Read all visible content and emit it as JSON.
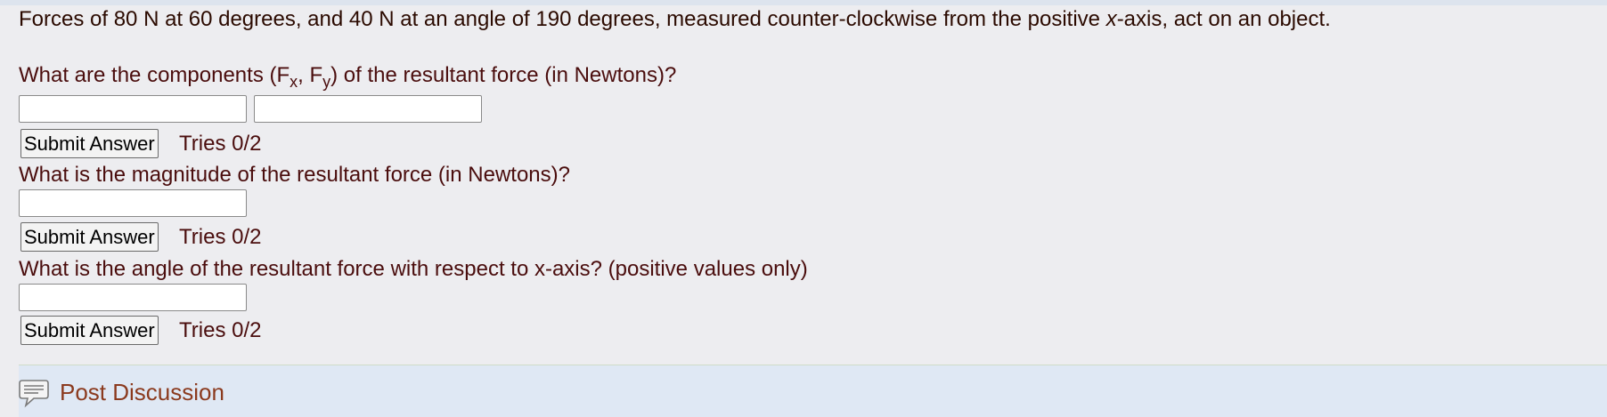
{
  "problem": {
    "text_before_x": "Forces of 80 N at 60 degrees, and 40 N at an angle of 190 degrees, measured counter-clockwise from the positive ",
    "x_var": "x",
    "text_after_x": "-axis, act on an object."
  },
  "questions": [
    {
      "prompt_start": "What are the components (F",
      "sub_x": "x",
      "prompt_mid": ", F",
      "sub_y": "y",
      "prompt_end": ") of the resultant force (in Newtons)?",
      "inputs": [
        "",
        ""
      ],
      "submit_label": "Submit Answer",
      "tries": "Tries 0/2"
    },
    {
      "prompt": "What is the magnitude of the resultant force (in Newtons)?",
      "inputs": [
        ""
      ],
      "submit_label": "Submit Answer",
      "tries": "Tries 0/2"
    },
    {
      "prompt": "What is the angle of the resultant force with respect to x-axis? (positive values only)",
      "inputs": [
        ""
      ],
      "submit_label": "Submit Answer",
      "tries": "Tries 0/2"
    }
  ],
  "discussion": {
    "icon": "discussion-bubble-icon",
    "label": "Post Discussion",
    "link_color": "#8b3a1e"
  },
  "colors": {
    "background": "#ededf0",
    "question_text": "#4a0d0d",
    "panel": "#dfe8f4"
  }
}
